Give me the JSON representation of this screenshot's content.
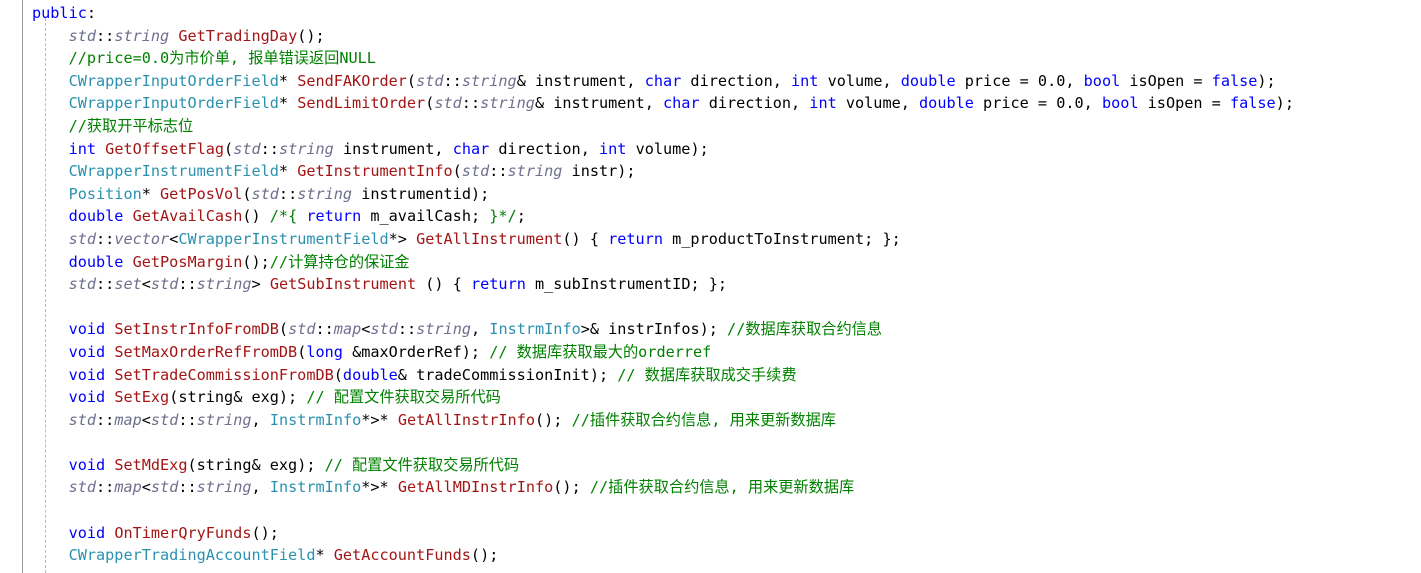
{
  "editor": {
    "background_color": "#ffffff",
    "margin_rule_color": "#9a9a9a",
    "indent_guide_color": "#b9b9b9",
    "font_size_px": 15,
    "line_height_px": 22.6,
    "language": "C++"
  },
  "palette": {
    "keyword": "#0000ff",
    "comment": "#008000",
    "class_type": "#2b91af",
    "function": "#a31515",
    "std_namespace": "#6f6f8f",
    "plain": "#000000"
  },
  "code": {
    "lines": [
      {
        "indent": 0,
        "tokens": [
          {
            "t": "public",
            "c": "kw"
          },
          {
            "t": ":",
            "c": "pl"
          }
        ]
      },
      {
        "indent": 1,
        "tokens": [
          {
            "t": "std",
            "c": "std"
          },
          {
            "t": "::",
            "c": "pl"
          },
          {
            "t": "string",
            "c": "std"
          },
          {
            "t": " ",
            "c": "pl"
          },
          {
            "t": "GetTradingDay",
            "c": "fn"
          },
          {
            "t": "();",
            "c": "pl"
          }
        ]
      },
      {
        "indent": 1,
        "tokens": [
          {
            "t": "//price=0.0为市价单, 报单错误返回NULL",
            "c": "cm"
          }
        ]
      },
      {
        "indent": 1,
        "tokens": [
          {
            "t": "CWrapperInputOrderField",
            "c": "cls"
          },
          {
            "t": "* ",
            "c": "pl"
          },
          {
            "t": "SendFAKOrder",
            "c": "fn"
          },
          {
            "t": "(",
            "c": "pl"
          },
          {
            "t": "std",
            "c": "std"
          },
          {
            "t": "::",
            "c": "pl"
          },
          {
            "t": "string",
            "c": "std"
          },
          {
            "t": "& instrument, ",
            "c": "pl"
          },
          {
            "t": "char",
            "c": "kw"
          },
          {
            "t": " direction, ",
            "c": "pl"
          },
          {
            "t": "int",
            "c": "kw"
          },
          {
            "t": " volume, ",
            "c": "pl"
          },
          {
            "t": "double",
            "c": "kw"
          },
          {
            "t": " price = ",
            "c": "pl"
          },
          {
            "t": "0.0",
            "c": "num"
          },
          {
            "t": ", ",
            "c": "pl"
          },
          {
            "t": "bool",
            "c": "kw"
          },
          {
            "t": " isOpen = ",
            "c": "pl"
          },
          {
            "t": "false",
            "c": "kw"
          },
          {
            "t": ");",
            "c": "pl"
          }
        ]
      },
      {
        "indent": 1,
        "tokens": [
          {
            "t": "CWrapperInputOrderField",
            "c": "cls"
          },
          {
            "t": "* ",
            "c": "pl"
          },
          {
            "t": "SendLimitOrder",
            "c": "fn"
          },
          {
            "t": "(",
            "c": "pl"
          },
          {
            "t": "std",
            "c": "std"
          },
          {
            "t": "::",
            "c": "pl"
          },
          {
            "t": "string",
            "c": "std"
          },
          {
            "t": "& instrument, ",
            "c": "pl"
          },
          {
            "t": "char",
            "c": "kw"
          },
          {
            "t": " direction, ",
            "c": "pl"
          },
          {
            "t": "int",
            "c": "kw"
          },
          {
            "t": " volume, ",
            "c": "pl"
          },
          {
            "t": "double",
            "c": "kw"
          },
          {
            "t": " price = ",
            "c": "pl"
          },
          {
            "t": "0.0",
            "c": "num"
          },
          {
            "t": ", ",
            "c": "pl"
          },
          {
            "t": "bool",
            "c": "kw"
          },
          {
            "t": " isOpen = ",
            "c": "pl"
          },
          {
            "t": "false",
            "c": "kw"
          },
          {
            "t": ");",
            "c": "pl"
          }
        ]
      },
      {
        "indent": 1,
        "tokens": [
          {
            "t": "//获取开平标志位",
            "c": "cm"
          }
        ]
      },
      {
        "indent": 1,
        "tokens": [
          {
            "t": "int",
            "c": "kw"
          },
          {
            "t": " ",
            "c": "pl"
          },
          {
            "t": "GetOffsetFlag",
            "c": "fn"
          },
          {
            "t": "(",
            "c": "pl"
          },
          {
            "t": "std",
            "c": "std"
          },
          {
            "t": "::",
            "c": "pl"
          },
          {
            "t": "string",
            "c": "std"
          },
          {
            "t": " instrument, ",
            "c": "pl"
          },
          {
            "t": "char",
            "c": "kw"
          },
          {
            "t": " direction, ",
            "c": "pl"
          },
          {
            "t": "int",
            "c": "kw"
          },
          {
            "t": " volume);",
            "c": "pl"
          }
        ]
      },
      {
        "indent": 1,
        "tokens": [
          {
            "t": "CWrapperInstrumentField",
            "c": "cls"
          },
          {
            "t": "* ",
            "c": "pl"
          },
          {
            "t": "GetInstrumentInfo",
            "c": "fn"
          },
          {
            "t": "(",
            "c": "pl"
          },
          {
            "t": "std",
            "c": "std"
          },
          {
            "t": "::",
            "c": "pl"
          },
          {
            "t": "string",
            "c": "std"
          },
          {
            "t": " instr);",
            "c": "pl"
          }
        ]
      },
      {
        "indent": 1,
        "tokens": [
          {
            "t": "Position",
            "c": "cls"
          },
          {
            "t": "* ",
            "c": "pl"
          },
          {
            "t": "GetPosVol",
            "c": "fn"
          },
          {
            "t": "(",
            "c": "pl"
          },
          {
            "t": "std",
            "c": "std"
          },
          {
            "t": "::",
            "c": "pl"
          },
          {
            "t": "string",
            "c": "std"
          },
          {
            "t": " instrumentid);",
            "c": "pl"
          }
        ]
      },
      {
        "indent": 1,
        "tokens": [
          {
            "t": "double",
            "c": "kw"
          },
          {
            "t": " ",
            "c": "pl"
          },
          {
            "t": "GetAvailCash",
            "c": "fn"
          },
          {
            "t": "() ",
            "c": "pl"
          },
          {
            "t": "/*{ ",
            "c": "cm"
          },
          {
            "t": "return",
            "c": "kw"
          },
          {
            "t": " m_availCash; ",
            "c": "pl"
          },
          {
            "t": "}*/",
            "c": "cm"
          },
          {
            "t": ";",
            "c": "pl"
          }
        ]
      },
      {
        "indent": 1,
        "tokens": [
          {
            "t": "std",
            "c": "std"
          },
          {
            "t": "::",
            "c": "pl"
          },
          {
            "t": "vector",
            "c": "std"
          },
          {
            "t": "<",
            "c": "pl"
          },
          {
            "t": "CWrapperInstrumentField",
            "c": "cls"
          },
          {
            "t": "*> ",
            "c": "pl"
          },
          {
            "t": "GetAllInstrument",
            "c": "fn"
          },
          {
            "t": "() { ",
            "c": "pl"
          },
          {
            "t": "return",
            "c": "kw"
          },
          {
            "t": " m_productToInstrument; };",
            "c": "pl"
          }
        ]
      },
      {
        "indent": 1,
        "tokens": [
          {
            "t": "double",
            "c": "kw"
          },
          {
            "t": " ",
            "c": "pl"
          },
          {
            "t": "GetPosMargin",
            "c": "fn"
          },
          {
            "t": "();",
            "c": "pl"
          },
          {
            "t": "//计算持仓的保证金",
            "c": "cm"
          }
        ]
      },
      {
        "indent": 1,
        "tokens": [
          {
            "t": "std",
            "c": "std"
          },
          {
            "t": "::",
            "c": "pl"
          },
          {
            "t": "set",
            "c": "std"
          },
          {
            "t": "<",
            "c": "pl"
          },
          {
            "t": "std",
            "c": "std"
          },
          {
            "t": "::",
            "c": "pl"
          },
          {
            "t": "string",
            "c": "std"
          },
          {
            "t": "> ",
            "c": "pl"
          },
          {
            "t": "GetSubInstrument",
            "c": "fn"
          },
          {
            "t": " () { ",
            "c": "pl"
          },
          {
            "t": "return",
            "c": "kw"
          },
          {
            "t": " m_subInstrumentID; };",
            "c": "pl"
          }
        ]
      },
      {
        "indent": 0,
        "tokens": []
      },
      {
        "indent": 1,
        "tokens": [
          {
            "t": "void",
            "c": "kw"
          },
          {
            "t": " ",
            "c": "pl"
          },
          {
            "t": "SetInstrInfoFromDB",
            "c": "fn"
          },
          {
            "t": "(",
            "c": "pl"
          },
          {
            "t": "std",
            "c": "std"
          },
          {
            "t": "::",
            "c": "pl"
          },
          {
            "t": "map",
            "c": "std"
          },
          {
            "t": "<",
            "c": "pl"
          },
          {
            "t": "std",
            "c": "std"
          },
          {
            "t": "::",
            "c": "pl"
          },
          {
            "t": "string",
            "c": "std"
          },
          {
            "t": ", ",
            "c": "pl"
          },
          {
            "t": "InstrmInfo",
            "c": "cls"
          },
          {
            "t": ">& instrInfos); ",
            "c": "pl"
          },
          {
            "t": "//数据库获取合约信息",
            "c": "cm"
          }
        ]
      },
      {
        "indent": 1,
        "tokens": [
          {
            "t": "void",
            "c": "kw"
          },
          {
            "t": " ",
            "c": "pl"
          },
          {
            "t": "SetMaxOrderRefFromDB",
            "c": "fn"
          },
          {
            "t": "(",
            "c": "pl"
          },
          {
            "t": "long",
            "c": "kw"
          },
          {
            "t": " &maxOrderRef); ",
            "c": "pl"
          },
          {
            "t": "// 数据库获取最大的orderref",
            "c": "cm"
          }
        ]
      },
      {
        "indent": 1,
        "tokens": [
          {
            "t": "void",
            "c": "kw"
          },
          {
            "t": " ",
            "c": "pl"
          },
          {
            "t": "SetTradeCommissionFromDB",
            "c": "fn"
          },
          {
            "t": "(",
            "c": "pl"
          },
          {
            "t": "double",
            "c": "kw"
          },
          {
            "t": "& tradeCommissionInit); ",
            "c": "pl"
          },
          {
            "t": "// 数据库获取成交手续费",
            "c": "cm"
          }
        ]
      },
      {
        "indent": 1,
        "tokens": [
          {
            "t": "void",
            "c": "kw"
          },
          {
            "t": " ",
            "c": "pl"
          },
          {
            "t": "SetExg",
            "c": "fn"
          },
          {
            "t": "(string& exg); ",
            "c": "pl"
          },
          {
            "t": "// 配置文件获取交易所代码",
            "c": "cm"
          }
        ]
      },
      {
        "indent": 1,
        "tokens": [
          {
            "t": "std",
            "c": "std"
          },
          {
            "t": "::",
            "c": "pl"
          },
          {
            "t": "map",
            "c": "std"
          },
          {
            "t": "<",
            "c": "pl"
          },
          {
            "t": "std",
            "c": "std"
          },
          {
            "t": "::",
            "c": "pl"
          },
          {
            "t": "string",
            "c": "std"
          },
          {
            "t": ", ",
            "c": "pl"
          },
          {
            "t": "InstrmInfo",
            "c": "cls"
          },
          {
            "t": "*>* ",
            "c": "pl"
          },
          {
            "t": "GetAllInstrInfo",
            "c": "fn"
          },
          {
            "t": "(); ",
            "c": "pl"
          },
          {
            "t": "//插件获取合约信息, 用来更新数据库",
            "c": "cm"
          }
        ]
      },
      {
        "indent": 0,
        "tokens": []
      },
      {
        "indent": 1,
        "tokens": [
          {
            "t": "void",
            "c": "kw"
          },
          {
            "t": " ",
            "c": "pl"
          },
          {
            "t": "SetMdExg",
            "c": "fn"
          },
          {
            "t": "(string& exg); ",
            "c": "pl"
          },
          {
            "t": "// 配置文件获取交易所代码",
            "c": "cm"
          }
        ]
      },
      {
        "indent": 1,
        "tokens": [
          {
            "t": "std",
            "c": "std"
          },
          {
            "t": "::",
            "c": "pl"
          },
          {
            "t": "map",
            "c": "std"
          },
          {
            "t": "<",
            "c": "pl"
          },
          {
            "t": "std",
            "c": "std"
          },
          {
            "t": "::",
            "c": "pl"
          },
          {
            "t": "string",
            "c": "std"
          },
          {
            "t": ", ",
            "c": "pl"
          },
          {
            "t": "InstrmInfo",
            "c": "cls"
          },
          {
            "t": "*>* ",
            "c": "pl"
          },
          {
            "t": "GetAllMDInstrInfo",
            "c": "fn"
          },
          {
            "t": "(); ",
            "c": "pl"
          },
          {
            "t": "//插件获取合约信息, 用来更新数据库",
            "c": "cm"
          }
        ]
      },
      {
        "indent": 0,
        "tokens": []
      },
      {
        "indent": 1,
        "tokens": [
          {
            "t": "void",
            "c": "kw"
          },
          {
            "t": " ",
            "c": "pl"
          },
          {
            "t": "OnTimerQryFunds",
            "c": "fn"
          },
          {
            "t": "();",
            "c": "pl"
          }
        ]
      },
      {
        "indent": 1,
        "tokens": [
          {
            "t": "CWrapperTradingAccountField",
            "c": "cls"
          },
          {
            "t": "* ",
            "c": "pl"
          },
          {
            "t": "GetAccountFunds",
            "c": "fn"
          },
          {
            "t": "();",
            "c": "pl"
          }
        ]
      }
    ]
  }
}
